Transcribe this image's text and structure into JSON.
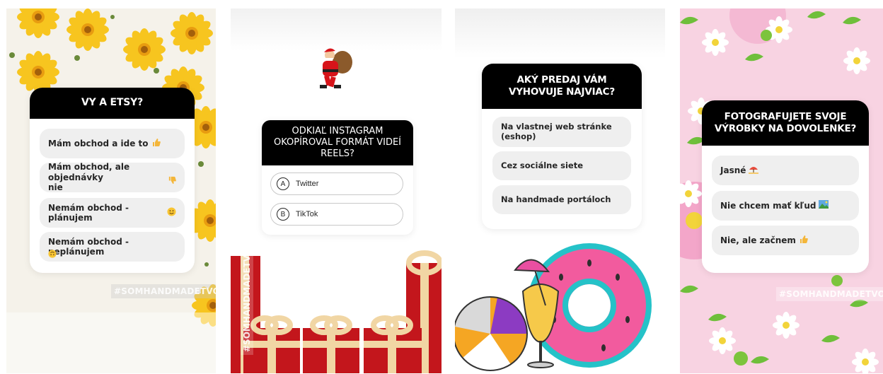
{
  "stories": [
    {
      "question": "Vy a Etsy?",
      "options": [
        {
          "label": "Mám obchod a ide to",
          "emoji": "thumbs-up-icon"
        },
        {
          "label": "Mám obchod, ale objednávky\nnie",
          "emoji": "thumbs-down-icon"
        },
        {
          "label": "Nemám obchod - plánujem",
          "emoji": "smiley-icon"
        },
        {
          "label": "Nemám obchod - neplánujem",
          "emoji": "upside-down-face-icon"
        }
      ],
      "hashtag": "#SOMHANDMADETVORCA"
    },
    {
      "question": "Odkiaľ Instagram okopíroval formát videí Reels?",
      "options": [
        {
          "letter": "A",
          "label": "Twitter"
        },
        {
          "letter": "B",
          "label": "TikTok"
        }
      ],
      "hashtag": "#SOMHANDMADETVORCA"
    },
    {
      "question": "Aký predaj vám vyhovuje najviac?",
      "options": [
        {
          "label": "Na vlastnej web stránke\n(eshop)"
        },
        {
          "label": "Cez sociálne siete"
        },
        {
          "label": "Na handmade portáloch"
        }
      ]
    },
    {
      "question": "Fotografujete svoje výrobky na dovolenke?",
      "options": [
        {
          "label": "Jasné",
          "emoji": "beach-umbrella-icon"
        },
        {
          "label": "Nie chcem mať kľud",
          "emoji": "landscape-icon"
        },
        {
          "label": "Nie, ale začnem",
          "emoji": "thumbs-up-icon"
        }
      ],
      "hashtag": "#SOMHANDMADETVORCA"
    }
  ]
}
